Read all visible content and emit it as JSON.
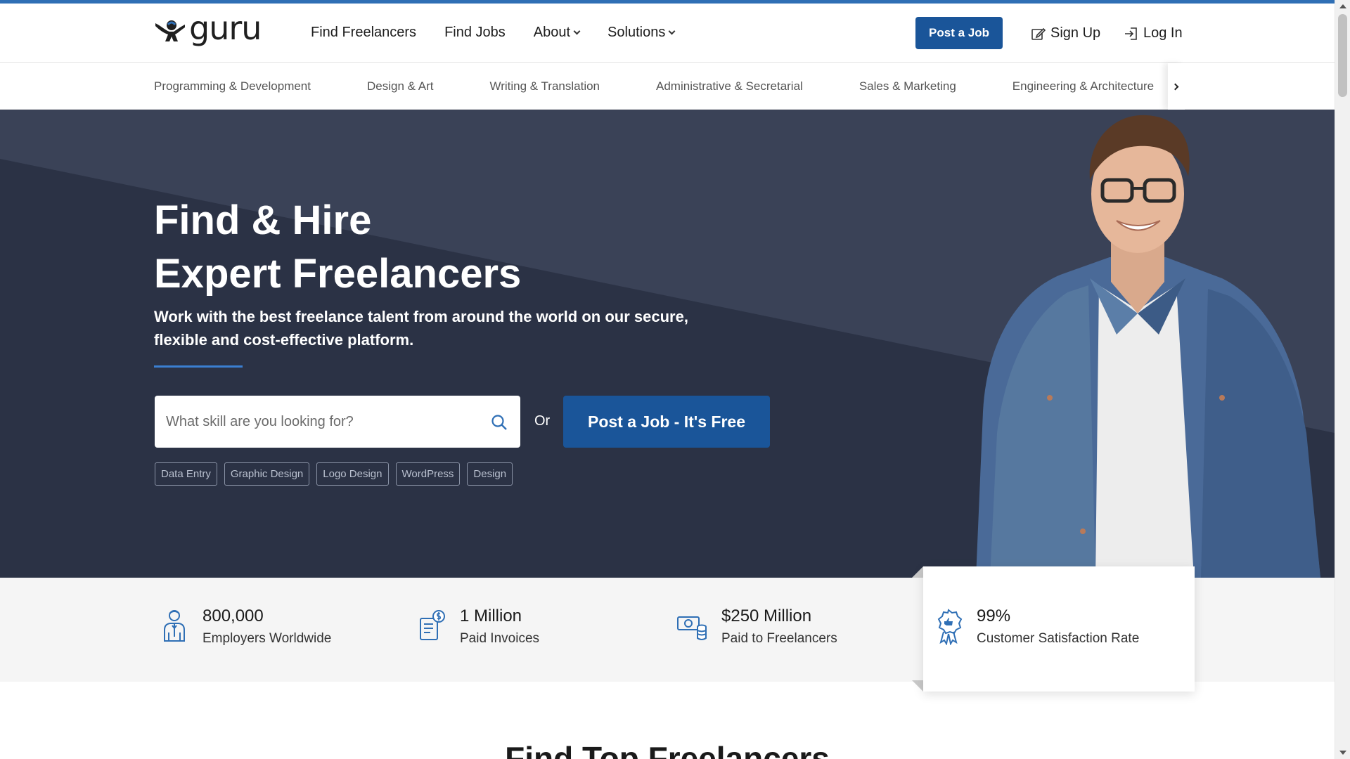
{
  "header": {
    "logo_text": "guru",
    "nav": [
      {
        "label": "Find Freelancers",
        "dropdown": false
      },
      {
        "label": "Find Jobs",
        "dropdown": false
      },
      {
        "label": "About",
        "dropdown": true
      },
      {
        "label": "Solutions",
        "dropdown": true
      }
    ],
    "post_job_label": "Post a Job",
    "signup_label": "Sign Up",
    "login_label": "Log In"
  },
  "categories": [
    "Programming & Development",
    "Design & Art",
    "Writing & Translation",
    "Administrative & Secretarial",
    "Sales & Marketing",
    "Engineering & Architecture"
  ],
  "hero": {
    "title_line1": "Find & Hire",
    "title_line2": "Expert Freelancers",
    "subtitle": "Work with the best freelance talent from around the world on our secure, flexible and cost-effective platform.",
    "search_placeholder": "What skill are you looking for?",
    "or_text": "Or",
    "post_job_cta": "Post a Job - It's Free",
    "tags": [
      "Data Entry",
      "Graphic Design",
      "Logo Design",
      "WordPress",
      "Design"
    ]
  },
  "stats": [
    {
      "value": "800,000",
      "label": "Employers Worldwide",
      "icon": "employer-icon"
    },
    {
      "value": "1 Million",
      "label": "Paid Invoices",
      "icon": "invoice-icon"
    },
    {
      "value": "$250 Million",
      "label": "Paid to Freelancers",
      "icon": "money-icon"
    },
    {
      "value": "99%",
      "label": "Customer Satisfaction Rate",
      "icon": "award-icon"
    }
  ],
  "section_title": "Find Top Freelancers",
  "colors": {
    "accent": "#2f6fb5",
    "button": "#1a5599",
    "hero_bg": "#2b3245",
    "icon_blue": "#2f6fb5"
  }
}
